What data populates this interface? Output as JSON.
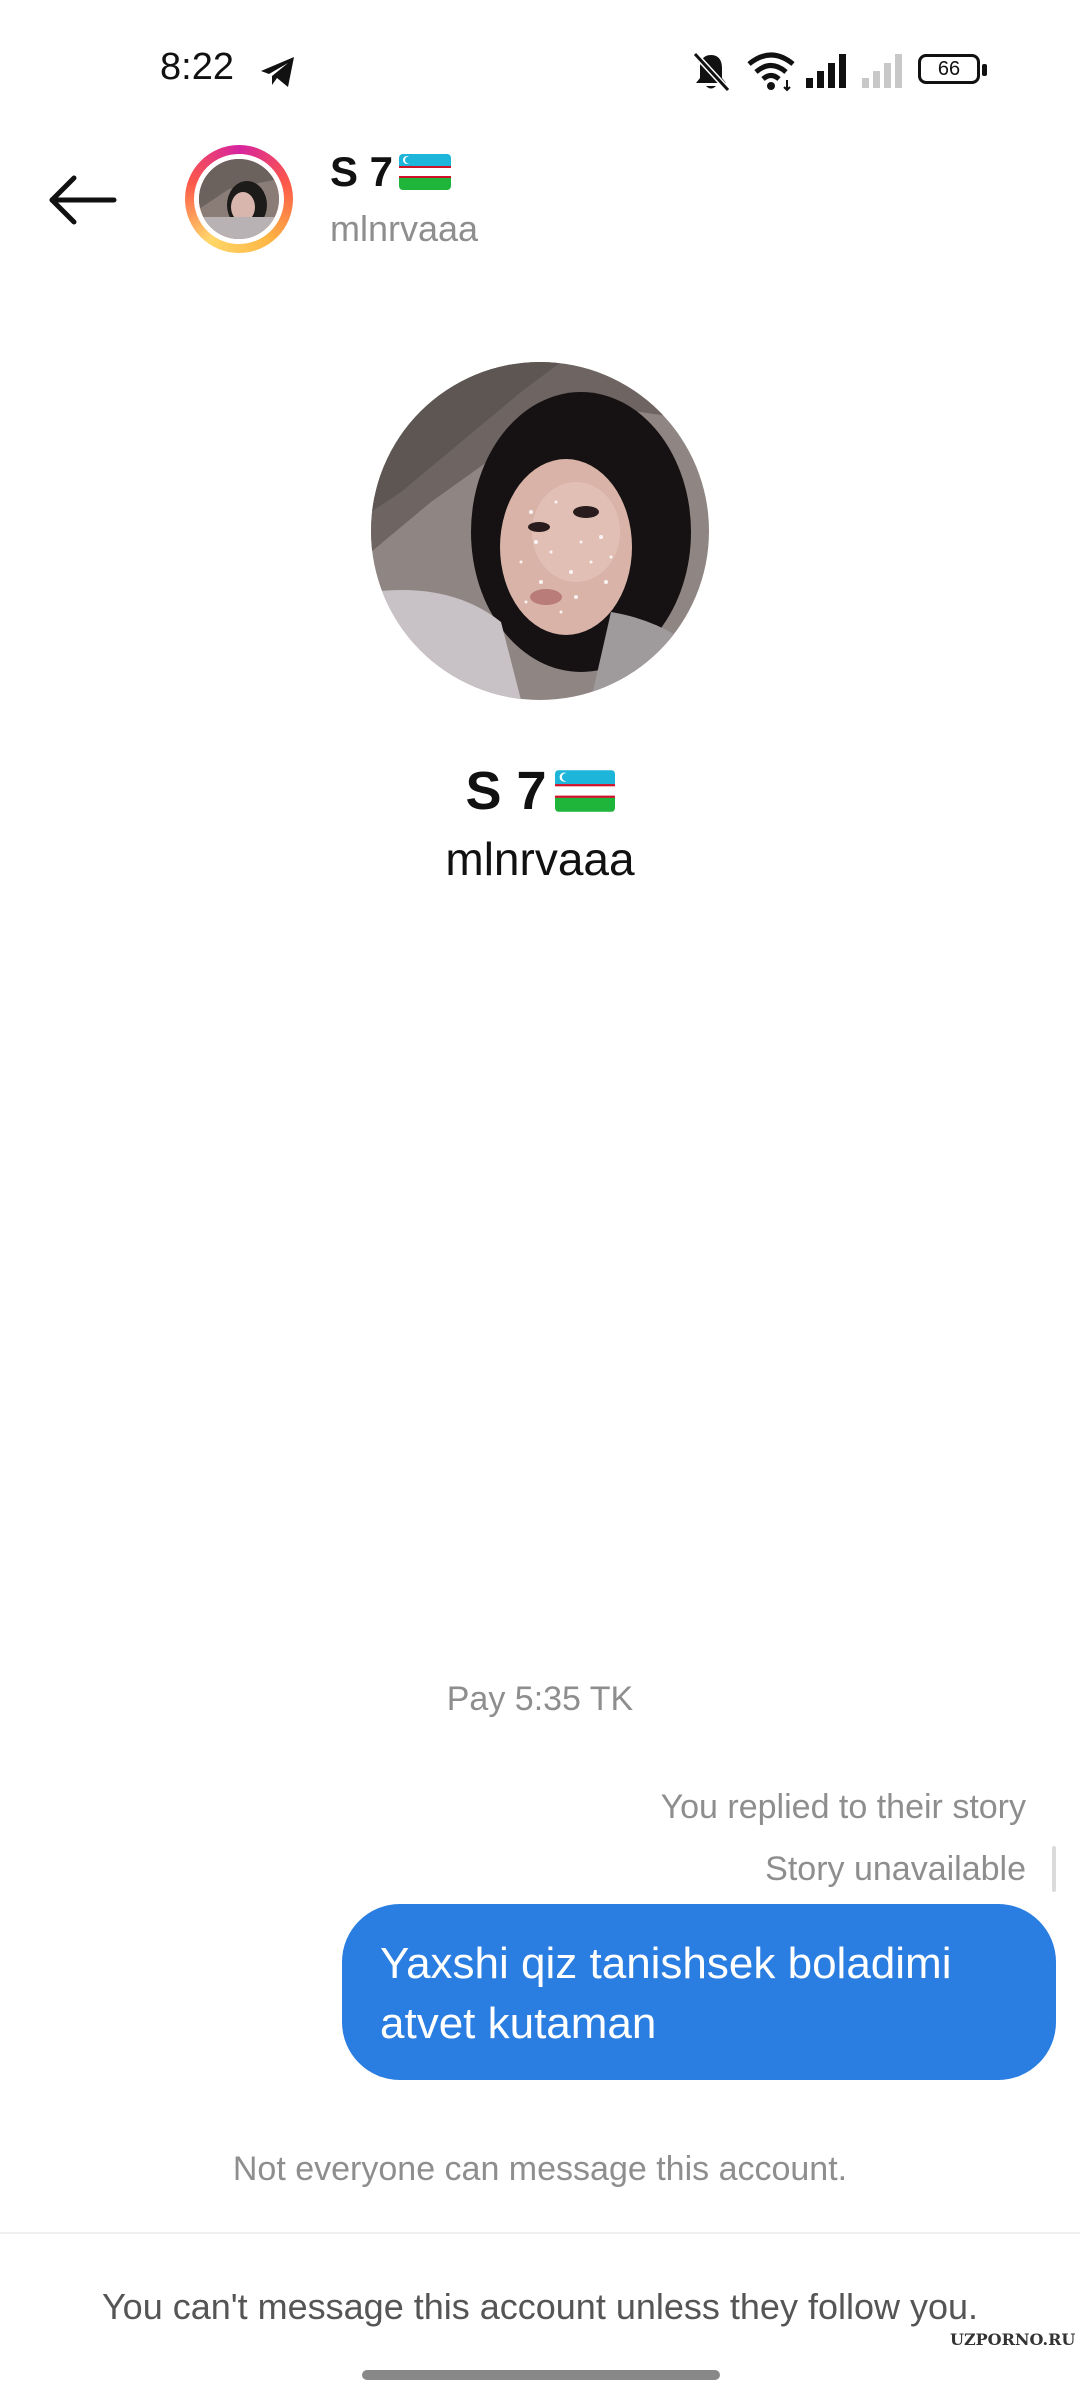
{
  "status_bar": {
    "time": "8:22",
    "battery": "66",
    "icons": [
      "telegram-icon",
      "mute-icon",
      "wifi-icon",
      "signal-icon",
      "signal-weak-icon",
      "battery-icon"
    ]
  },
  "header": {
    "back_icon": "arrow-left-icon",
    "name": "S 7",
    "username": "mlnrvaaa"
  },
  "profile": {
    "name": "S 7",
    "username": "mlnrvaaa"
  },
  "conversation": {
    "timestamp": "Pay 5:35 TK",
    "reply_note": "You replied to their story",
    "story_status": "Story unavailable",
    "message_line1": "Yaxshi qiz tanishsek boladimi",
    "message_line2": "atvet kutaman"
  },
  "footer": {
    "restriction_note": "Not everyone can message this account.",
    "cant_message": "You can't message this account unless they follow you."
  },
  "watermark": "UZPORNO.RU",
  "colors": {
    "bubble": "#2a7de1",
    "muted_text": "#8e8e8e"
  }
}
